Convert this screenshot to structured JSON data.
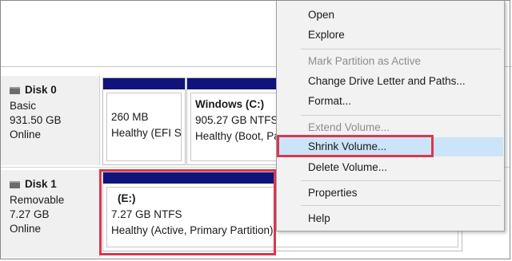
{
  "disks": [
    {
      "name": "Disk 0",
      "type": "Basic",
      "size": "931.50 GB",
      "status": "Online",
      "volumes": [
        {
          "title": "",
          "size_fs": "260 MB",
          "status": "Healthy (EFI Sy"
        },
        {
          "title": "Windows  (C:)",
          "size_fs": "905.27 GB NTFS",
          "status": "Healthy (Boot, Pa"
        }
      ]
    },
    {
      "name": "Disk 1",
      "type": "Removable",
      "size": "7.27 GB",
      "status": "Online",
      "volumes": [
        {
          "title": "(E:)",
          "size_fs": "7.27 GB NTFS",
          "status": "Healthy (Active, Primary Partition)"
        }
      ]
    }
  ],
  "context_menu": {
    "items": [
      {
        "label": "Open",
        "enabled": true
      },
      {
        "label": "Explore",
        "enabled": true
      },
      {
        "label": "Mark Partition as Active",
        "enabled": false
      },
      {
        "label": "Change Drive Letter and Paths...",
        "enabled": true
      },
      {
        "label": "Format...",
        "enabled": true
      },
      {
        "label": "Extend Volume...",
        "enabled": false
      },
      {
        "label": "Shrink Volume...",
        "enabled": true,
        "highlighted": true
      },
      {
        "label": "Delete Volume...",
        "enabled": true
      },
      {
        "label": "Properties",
        "enabled": true
      },
      {
        "label": "Help",
        "enabled": true
      }
    ]
  },
  "colors": {
    "partition_bar": "#10147a",
    "highlight": "#cce4f7",
    "callout_red": "#d9374e"
  },
  "icons": {
    "disk": "disk-drive-icon"
  }
}
